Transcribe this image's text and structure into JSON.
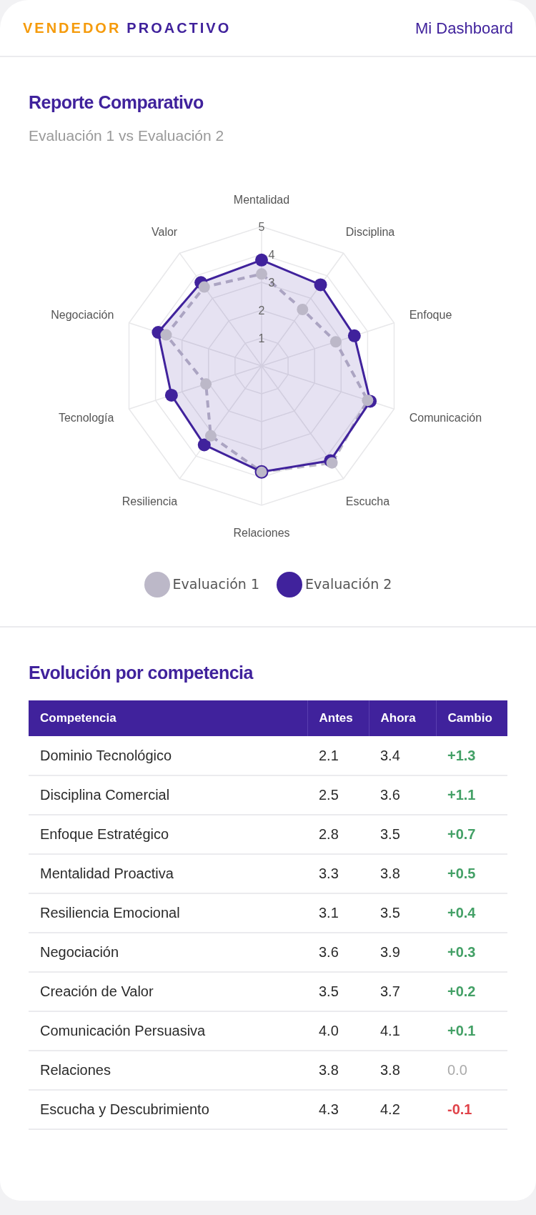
{
  "header": {
    "brand_first": "VENDEDOR",
    "brand_second": "PROACTIVO",
    "nav_link": "Mi Dashboard"
  },
  "report": {
    "title": "Reporte Comparativo",
    "subtitle": "Evaluación 1 vs Evaluación 2",
    "radar": {
      "axis_labels": [
        "Mentalidad",
        "Disciplina",
        "Enfoque",
        "Comunicación",
        "Escucha",
        "Relaciones",
        "Resiliencia",
        "Tecnología",
        "Negociación",
        "Valor"
      ],
      "ticks": [
        "5",
        "4",
        "3",
        "2",
        "1"
      ],
      "legend": [
        {
          "name": "Evaluación 1",
          "color": "#bcb8c8"
        },
        {
          "name": "Evaluación 2",
          "color": "#40229c"
        }
      ]
    }
  },
  "evolution": {
    "title": "Evolución por competencia",
    "table": {
      "columns": [
        "Competencia",
        "Antes",
        "Ahora",
        "Cambio"
      ],
      "rows": [
        {
          "competencia": "Dominio Tecnológico",
          "antes": "2.1",
          "ahora": "3.4",
          "cambio": "+1.3",
          "kind": "up"
        },
        {
          "competencia": "Disciplina Comercial",
          "antes": "2.5",
          "ahora": "3.6",
          "cambio": "+1.1",
          "kind": "up"
        },
        {
          "competencia": "Enfoque Estratégico",
          "antes": "2.8",
          "ahora": "3.5",
          "cambio": "+0.7",
          "kind": "up"
        },
        {
          "competencia": "Mentalidad Proactiva",
          "antes": "3.3",
          "ahora": "3.8",
          "cambio": "+0.5",
          "kind": "up"
        },
        {
          "competencia": "Resiliencia Emocional",
          "antes": "3.1",
          "ahora": "3.5",
          "cambio": "+0.4",
          "kind": "up"
        },
        {
          "competencia": "Negociación",
          "antes": "3.6",
          "ahora": "3.9",
          "cambio": "+0.3",
          "kind": "up"
        },
        {
          "competencia": "Creación de Valor",
          "antes": "3.5",
          "ahora": "3.7",
          "cambio": "+0.2",
          "kind": "up"
        },
        {
          "competencia": "Comunicación Persuasiva",
          "antes": "4.0",
          "ahora": "4.1",
          "cambio": "+0.1",
          "kind": "up"
        },
        {
          "competencia": "Relaciones",
          "antes": "3.8",
          "ahora": "3.8",
          "cambio": "0.0",
          "kind": "flat"
        },
        {
          "competencia": "Escucha y Descubrimiento",
          "antes": "4.3",
          "ahora": "4.2",
          "cambio": "-0.1",
          "kind": "down"
        }
      ]
    }
  }
}
